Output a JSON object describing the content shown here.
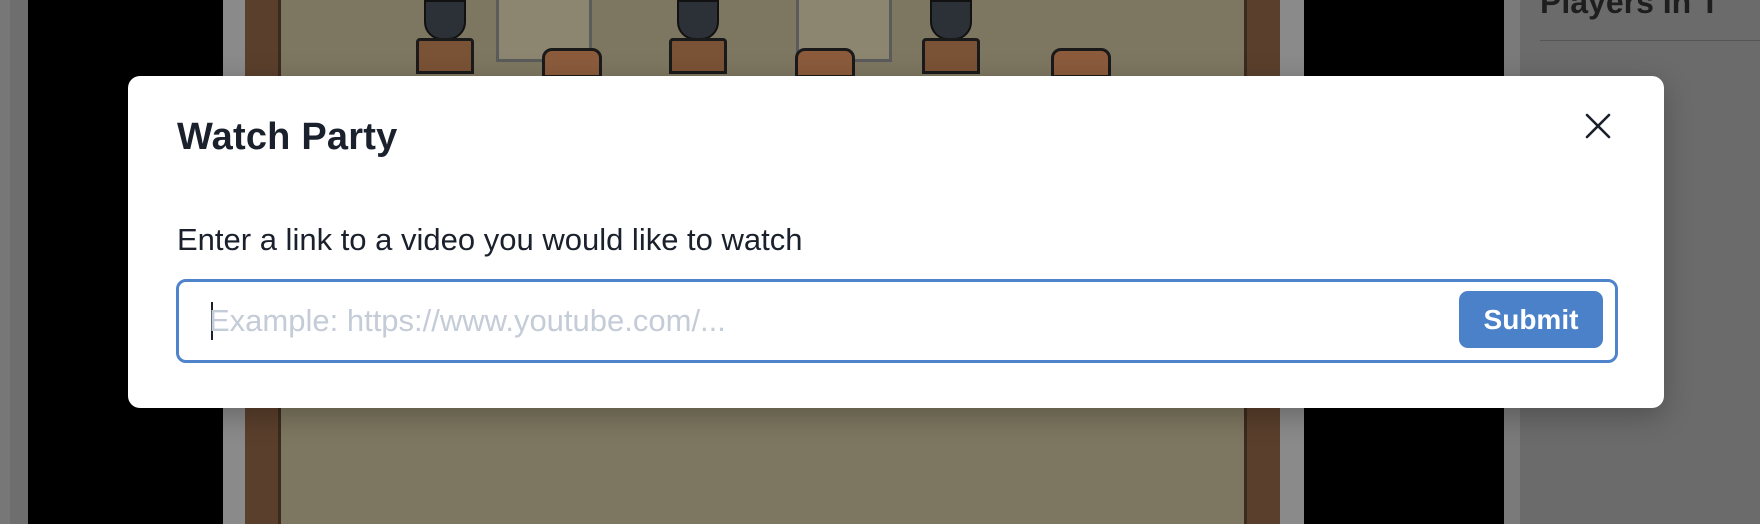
{
  "background": {
    "side_panel_title": "Players In T"
  },
  "modal": {
    "title": "Watch Party",
    "label": "Enter a link to a video you would like to watch",
    "input": {
      "value": "",
      "placeholder": "Example: https://www.youtube.com/..."
    },
    "submit_label": "Submit",
    "close_icon": "close-icon"
  },
  "colors": {
    "accent": "#4a81c9",
    "input_border": "#4f83cc",
    "title_text": "#1a202c",
    "placeholder_text": "#c4ccd8"
  }
}
